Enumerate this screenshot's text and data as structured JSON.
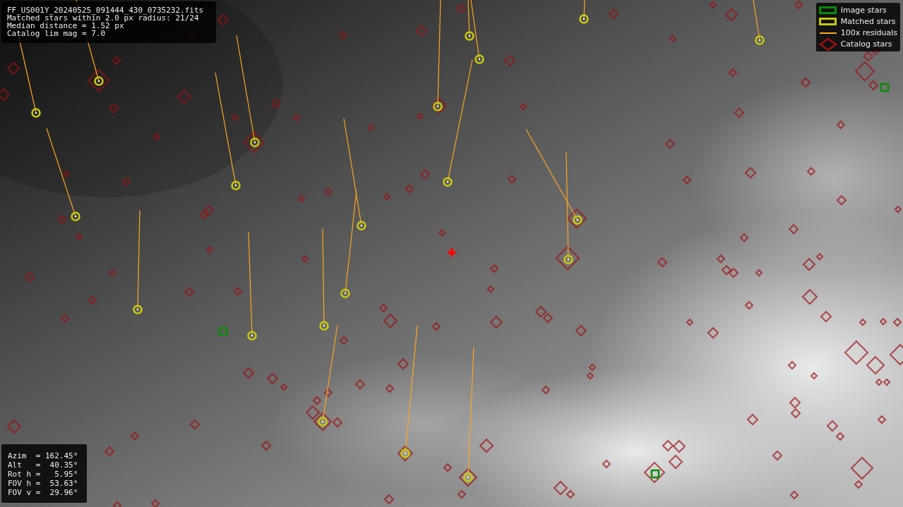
{
  "info": {
    "lines": [
      "FF_US001Y_20240525_091444_430_0735232.fits",
      "Matched stars within 2.0 px radius: 21/24",
      "Median distance = 1.52 px",
      "Catalog lim mag = 7.0"
    ]
  },
  "legend": {
    "items": [
      {
        "label": "Image stars",
        "color": "#0b8a0b"
      },
      {
        "kind": "matched",
        "label": "Matched stars",
        "color": "#c8c810"
      },
      {
        "kind": "residual",
        "label": "100x residuals",
        "color": "#ffa520"
      },
      {
        "kind": "catalog",
        "label": "Catalog stars",
        "color": "#a01010"
      }
    ]
  },
  "pointing": {
    "lines": [
      "Azim  = 162.45°",
      "Alt   =  40.35°",
      "Rot h =   5.95°",
      "FOV h =  53.63°",
      "FOV v =  29.96°"
    ]
  }
}
